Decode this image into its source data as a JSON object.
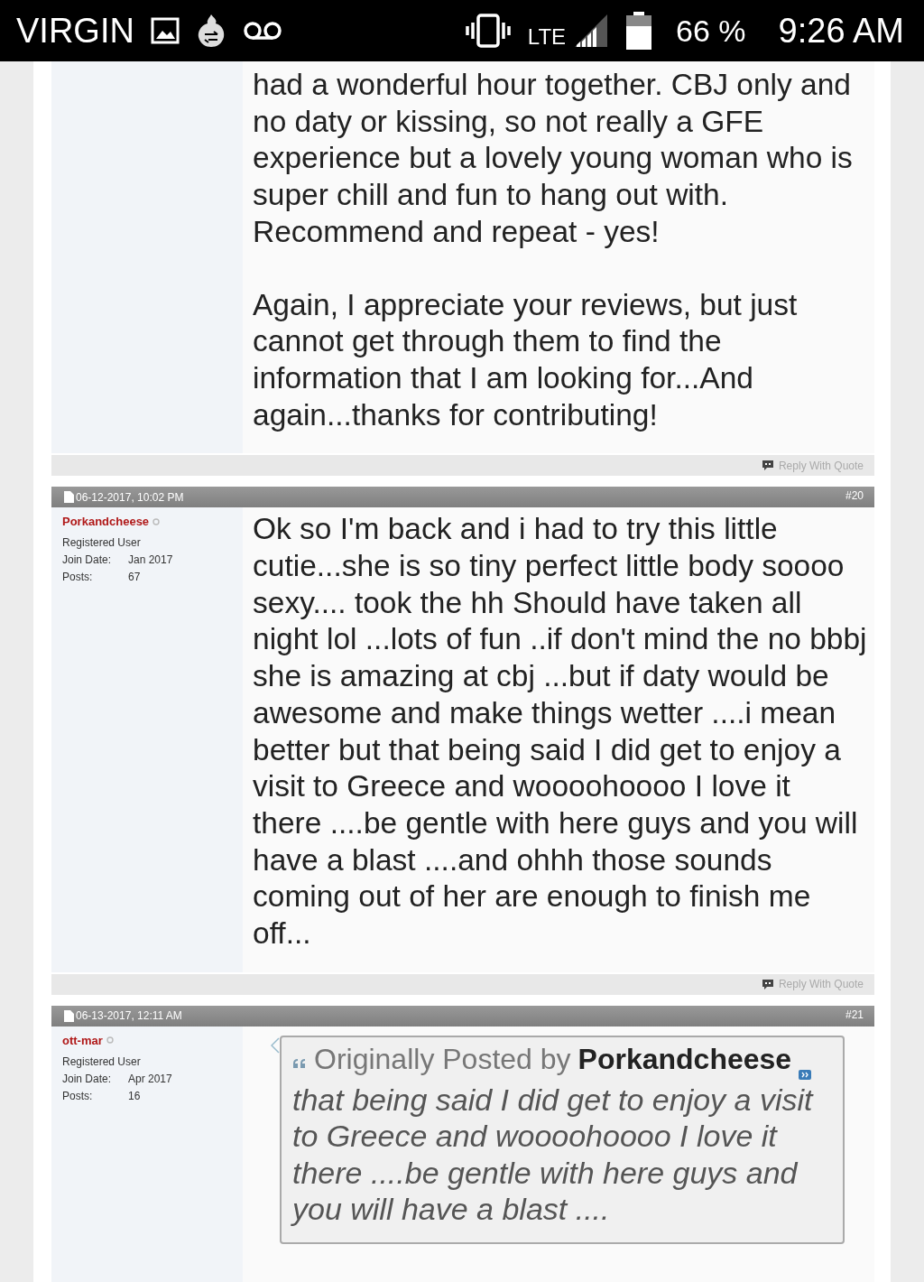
{
  "status_bar": {
    "carrier": "VIRGIN",
    "network": "LTE",
    "battery": "66 %",
    "time": "9:26 AM"
  },
  "posts": [
    {
      "paragraphs": [
        "had a wonderful hour together. CBJ only and no daty or kissing, so not really a GFE experience but a lovely young woman who is super chill and fun to hang out with. Recommend and repeat - yes!",
        "Again, I appreciate your reviews, but just cannot get through them to find the information that I am looking for...And again...thanks for contributing!"
      ],
      "reply_label": "Reply With Quote"
    },
    {
      "date": "06-12-2017, 10:02 PM",
      "number": "#20",
      "user": {
        "name": "Porkandcheese",
        "online": false,
        "title": "Registered User",
        "join_label": "Join Date:",
        "join_date": "Jan 2017",
        "posts_label": "Posts:",
        "posts": "67"
      },
      "paragraphs": [
        "Ok so I'm back and i had to try this little cutie...she is so tiny perfect little body soooo sexy.... took the hh Should have taken all night lol ...lots of fun ..if don't mind the no bbbj she is amazing at cbj ...but if daty would be awesome and make things wetter ....i mean better but that being said I did get to enjoy a visit to Greece and woooohoooo I love it there ....be gentle with here guys and you will have a blast ....and ohhh those sounds coming out of her are enough to finish me off..."
      ],
      "reply_label": "Reply With Quote"
    },
    {
      "date": "06-13-2017, 12:11 AM",
      "number": "#21",
      "user": {
        "name": "ott-mar",
        "online": false,
        "title": "Registered User",
        "join_label": "Join Date:",
        "join_date": "Apr 2017",
        "posts_label": "Posts:",
        "posts": "16"
      },
      "quote": {
        "lead": "Originally Posted by",
        "author": "Porkandcheese",
        "text": "that being said I did get to enjoy a visit to Greece and woooohoooo I love it there ....be gentle with here guys and you will have a blast ...."
      }
    }
  ]
}
